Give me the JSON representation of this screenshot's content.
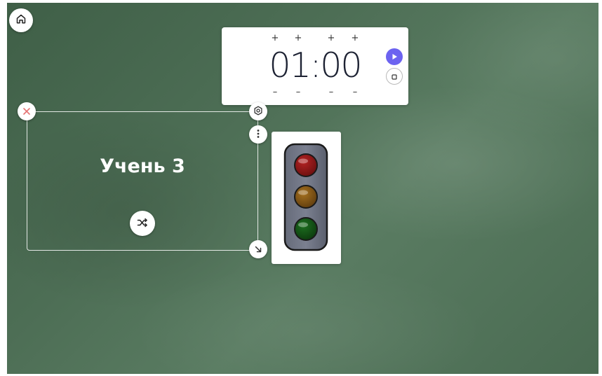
{
  "timer": {
    "display": "01:00",
    "increment_label": "+",
    "decrement_label": "–"
  },
  "picker": {
    "name": "Учень 3"
  },
  "traffic_light": {
    "colors": {
      "red": "#8b1414",
      "yellow": "#8a5a16",
      "green": "#145416"
    }
  },
  "icons": {
    "home": "home-icon",
    "play": "play-icon",
    "stop": "stop-icon",
    "close": "close-icon",
    "settings": "gear-icon",
    "more": "more-vertical-icon",
    "resize": "resize-arrow-icon",
    "shuffle": "shuffle-icon"
  },
  "colors": {
    "board": "#4d6e55",
    "accent": "#6c63f0",
    "close": "#e57373"
  }
}
